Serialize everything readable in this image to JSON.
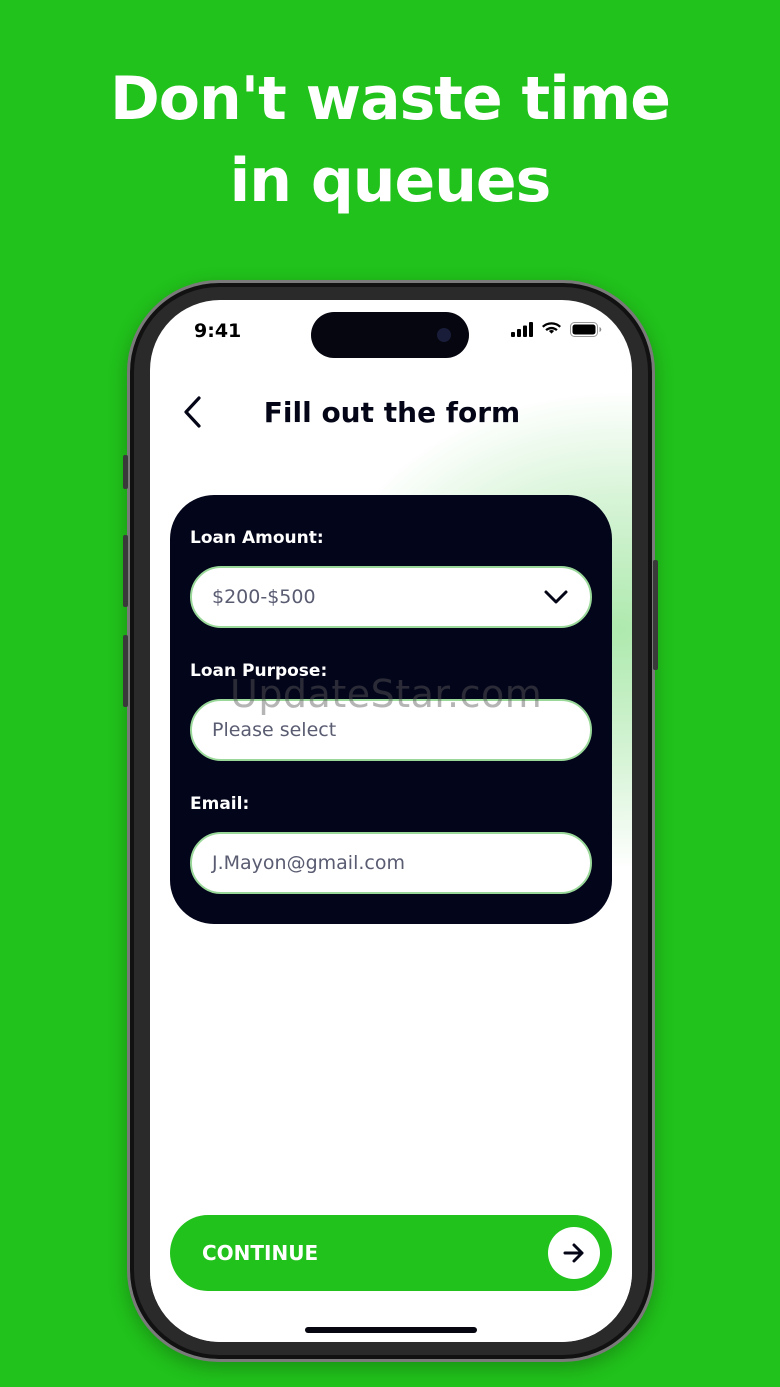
{
  "headline": {
    "line1": "Don't waste time",
    "line2": "in queues"
  },
  "status_bar": {
    "time": "9:41",
    "icons": [
      "cellular-signal-icon",
      "wifi-icon",
      "battery-icon"
    ]
  },
  "header": {
    "back_icon": "chevron-left-icon",
    "title": "Fill out the form"
  },
  "form": {
    "loan_amount": {
      "label": "Loan Amount:",
      "value": "$200-$500",
      "icon": "chevron-down-icon"
    },
    "loan_purpose": {
      "label": "Loan Purpose:",
      "placeholder": "Please select"
    },
    "email": {
      "label": "Email:",
      "value": "J.Mayon@gmail.com"
    }
  },
  "watermark": "UpdateStar.com",
  "continue_button": {
    "label": "CONTINUE",
    "icon": "arrow-right-icon"
  },
  "colors": {
    "background": "#21c21b",
    "card": "#03051a",
    "field_border": "#9ad89a",
    "title_text": "#040617"
  }
}
